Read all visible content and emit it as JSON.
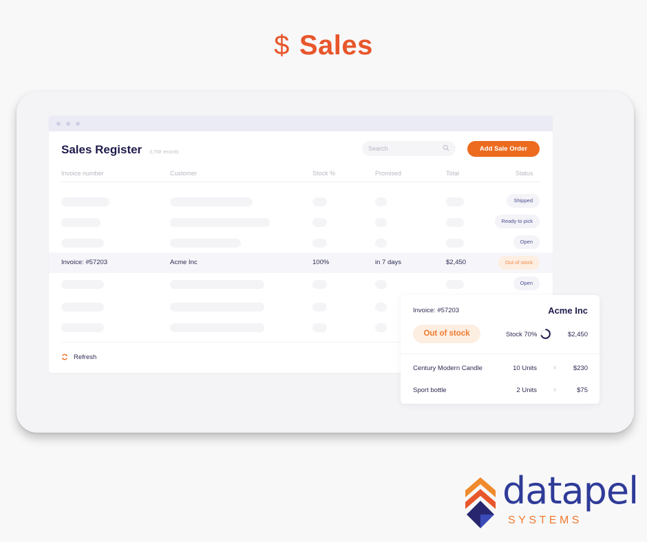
{
  "hero": {
    "icon": "dollar-icon",
    "icon_glyph": "$",
    "title": "Sales"
  },
  "window": {
    "title": "Sales Register",
    "records": "3,768 records",
    "search_placeholder": "Search",
    "add_button": "Add Sale Order",
    "columns": [
      "Invoice number",
      "Customer",
      "Stock %",
      "Promised",
      "Total",
      "Status"
    ],
    "rows": [
      {
        "placeholder": true,
        "status": "Shipped",
        "status_type": "neutral"
      },
      {
        "placeholder": true,
        "status": "Ready to pick",
        "status_type": "neutral"
      },
      {
        "placeholder": true,
        "status": "Open",
        "status_type": "neutral"
      },
      {
        "placeholder": false,
        "invoice": "Invoice: #57203",
        "customer": "Acme Inc",
        "stock": "100%",
        "promised": "in 7 days",
        "total": "$2,450",
        "status": "Out of stock",
        "status_type": "warning"
      },
      {
        "placeholder": true,
        "status": "Open",
        "status_type": "neutral"
      },
      {
        "placeholder": true,
        "status": "",
        "status_type": "neutral"
      },
      {
        "placeholder": true,
        "status": "",
        "status_type": "neutral"
      }
    ],
    "refresh_label": "Refresh"
  },
  "detail": {
    "invoice": "Invoice: #57203",
    "customer": "Acme Inc",
    "status": "Out of stock",
    "stock_label": "Stock 70%",
    "stock_fraction": 0.7,
    "total": "$2,450",
    "items": [
      {
        "name": "Century Modern Candle",
        "qty": "10 Units",
        "x": "x",
        "price": "$230"
      },
      {
        "name": "Sport bottle",
        "qty": "2 Units",
        "x": "x",
        "price": "$75"
      }
    ]
  },
  "logo": {
    "word": "datapel",
    "sub": "SYSTEMS"
  },
  "colors": {
    "accent": "#ec6b1f",
    "hero": "#e8562b",
    "brand_blue": "#2f3b98",
    "warning_bg": "#fdeee2"
  }
}
